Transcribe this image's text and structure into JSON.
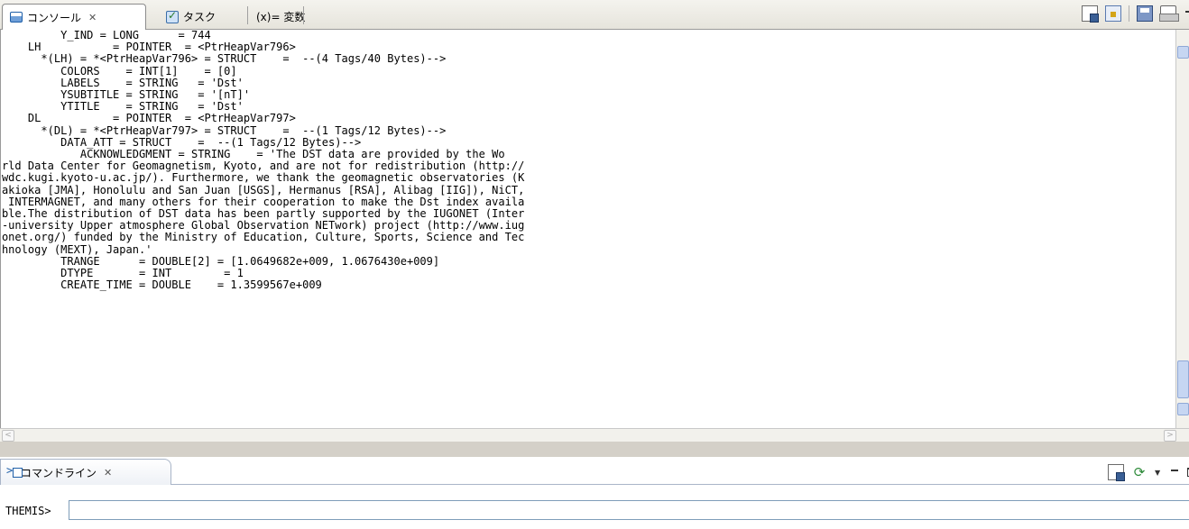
{
  "console_view": {
    "tabs": [
      {
        "label": "コンソール",
        "close": "✕",
        "active": true
      },
      {
        "label": "タスク",
        "active": false
      },
      {
        "label": "(x)= 変数",
        "active": false
      }
    ],
    "toolbar_icons": [
      "clear-console-icon",
      "scroll-lock-icon",
      "save-icon",
      "print-icon"
    ],
    "lines": [
      "         Y_IND = LONG      = 744",
      "    LH           = POINTER  = <PtrHeapVar796>",
      "      *(LH) = *<PtrHeapVar796> = STRUCT    =  --(4 Tags/40 Bytes)-->",
      "         COLORS    = INT[1]    = [0]",
      "         LABELS    = STRING   = 'Dst'",
      "         YSUBTITLE = STRING   = '[nT]'",
      "         YTITLE    = STRING   = 'Dst'",
      "    DL           = POINTER  = <PtrHeapVar797>",
      "      *(DL) = *<PtrHeapVar797> = STRUCT    =  --(1 Tags/12 Bytes)-->",
      "         DATA_ATT = STRUCT    =  --(1 Tags/12 Bytes)-->",
      "            ACKNOWLEDGMENT = STRING    = 'The DST data are provided by the Wo",
      "rld Data Center for Geomagnetism, Kyoto, and are not for redistribution (http://",
      "wdc.kugi.kyoto-u.ac.jp/). Furthermore, we thank the geomagnetic observatories (K",
      "akioka [JMA], Honolulu and San Juan [USGS], Hermanus [RSA], Alibag [IIG]), NiCT,",
      " INTERMAGNET, and many others for their cooperation to make the Dst index availa",
      "ble.The distribution of DST data has been partly supported by the IUGONET (Inter",
      "-university Upper atmosphere Global Observation NETwork) project (http://www.iug",
      "onet.org/) funded by the Ministry of Education, Culture, Sports, Science and Tec",
      "hnology (MEXT), Japan.'",
      "         TRANGE      = DOUBLE[2] = [1.0649682e+009, 1.0676430e+009]",
      "         DTYPE       = INT        = 1",
      "         CREATE_TIME = DOUBLE    = 1.3599567e+009"
    ]
  },
  "command_view": {
    "tab_label": "コマンドライン",
    "tab_close": "✕",
    "prompt": "THEMIS>",
    "input_value": "",
    "toolbar_icons": [
      "clear-icon",
      "refresh-icon",
      "dropdown-icon"
    ]
  }
}
